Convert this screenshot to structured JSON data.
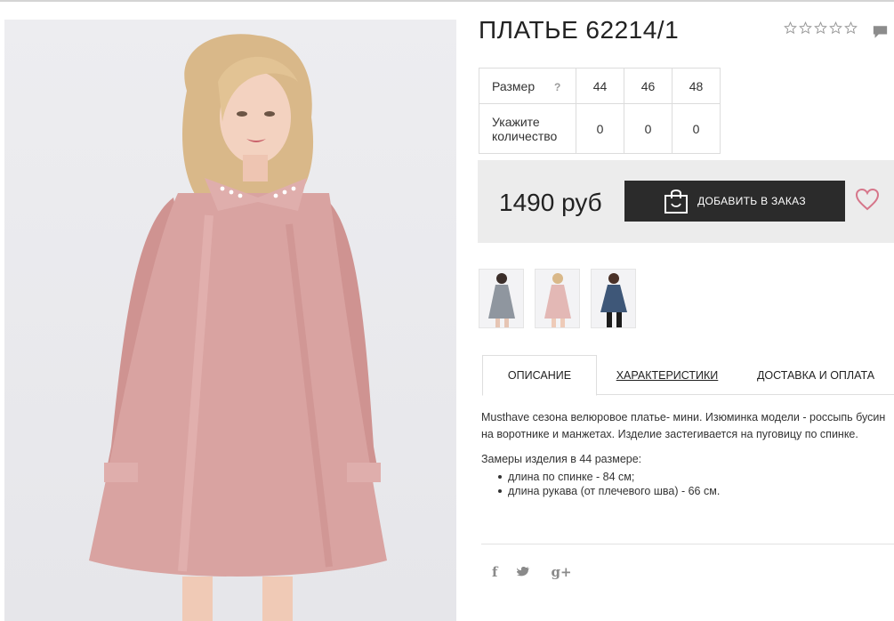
{
  "product": {
    "title": "ПЛАТЬЕ 62214/1",
    "rating": 0,
    "rating_max": 5
  },
  "sizes": {
    "size_label": "Размер",
    "help": "?",
    "qty_label_line1": "Укажите",
    "qty_label_line2": "количество",
    "columns": [
      "44",
      "46",
      "48"
    ],
    "quantities": [
      "0",
      "0",
      "0"
    ]
  },
  "buy": {
    "price": "1490 руб",
    "add_button_label": "ДОБАВИТЬ В ЗАКАЗ"
  },
  "thumbnails": [
    {
      "name": "grey",
      "color": "#8f969f"
    },
    {
      "name": "pink",
      "color": "#e3b8b5"
    },
    {
      "name": "blue",
      "color": "#3e5778"
    }
  ],
  "tabs": {
    "description": "ОПИСАНИЕ",
    "specs": "ХАРАКТЕРИСТИКИ",
    "delivery": "ДОСТАВКА И ОПЛАТА"
  },
  "description": {
    "text": "Musthave сезона велюровое платье- мини. Изюминка модели - россыпь бусин на воротнике и манжетах. Изделие застегивается на пуговицу по спинке.",
    "measure_title": "Замеры изделия в 44 размере:",
    "items": [
      "длина по спинке - 84 см;",
      "длина рукава (от плечевого шва) - 66 см."
    ]
  },
  "social": {
    "facebook": "f",
    "twitter": "t",
    "googleplus": "g+"
  },
  "colors": {
    "dress": "#d9a3a1",
    "button": "#2b2b2b",
    "heart": "#d6768a",
    "buybox": "#ececec"
  }
}
